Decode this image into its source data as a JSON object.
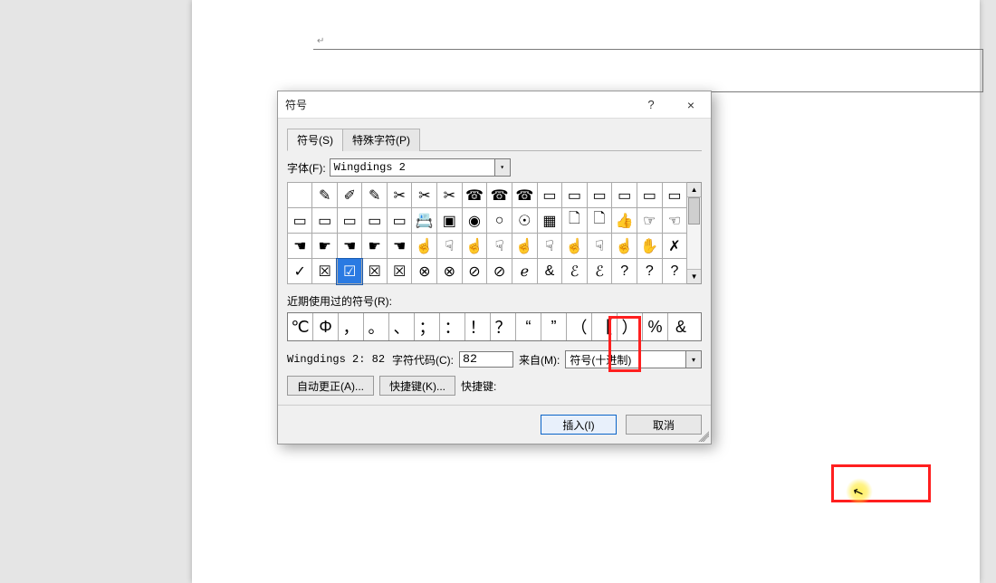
{
  "doc": {
    "para_mark": "↵"
  },
  "dialog": {
    "title": "符号",
    "help": "?",
    "close": "×",
    "tabs": {
      "symbols": "符号(S)",
      "special": "特殊字符(P)"
    },
    "font_label": "字体(F):",
    "font_value": "Wingdings 2",
    "grid": [
      [
        "",
        "✎",
        "✐",
        "✎",
        "✂",
        "✂",
        "✂",
        "☎",
        "☎",
        "☎",
        "▭",
        "▭",
        "▭",
        "▭",
        "▭",
        "▭"
      ],
      [
        "▭",
        "▭",
        "▭",
        "▭",
        "▭",
        "📇",
        "▣",
        "◉",
        "○",
        "☉",
        "▦",
        "🗋",
        "🗋",
        "👍",
        "☞",
        "☜"
      ],
      [
        "☚",
        "☛",
        "☚",
        "☛",
        "☚",
        "☝",
        "☟",
        "☝",
        "☟",
        "☝",
        "☟",
        "☝",
        "☟",
        "☝",
        "✋",
        "✗"
      ],
      [
        "✓",
        "☒",
        "☑",
        "☒",
        "☒",
        "⊗",
        "⊗",
        "⊘",
        "⊘",
        "ℯ",
        "&",
        "ℰ",
        "ℰ",
        "?",
        "?",
        "?"
      ]
    ],
    "selected_row": 3,
    "selected_col": 2,
    "recent_label": "近期使用过的符号(R):",
    "recent": [
      "℃",
      "Φ",
      "，",
      "。",
      "、",
      "；",
      "：",
      "！",
      "？",
      "“",
      "”",
      "（",
      "【",
      "）",
      "%",
      "&"
    ],
    "unicode_name": "Wingdings 2: 82",
    "charcode_label": "字符代码(C):",
    "charcode_value": "82",
    "from_label": "来自(M):",
    "from_value": "符号(十进制)",
    "autocorrect_btn": "自动更正(A)...",
    "shortcutkey_btn": "快捷键(K)...",
    "shortcut_label": "快捷键:",
    "insert_btn": "插入(I)",
    "cancel_btn": "取消"
  }
}
